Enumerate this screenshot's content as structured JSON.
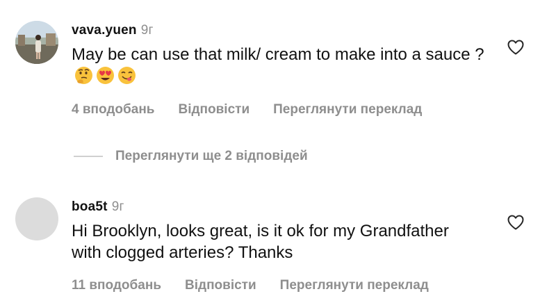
{
  "comments": [
    {
      "username": "vava.yuen",
      "time": "9г",
      "text": "May be can use that milk/ cream to make into a sauce ?",
      "emojis": [
        "thinking-face-emoji",
        "heart-eyes-emoji",
        "yum-face-emoji"
      ],
      "likes": "4 вподобань",
      "reply": "Відповісти",
      "translate": "Переглянути переклад"
    },
    {
      "username": "boa5t",
      "time": "9г",
      "text": "Hi Brooklyn, looks great, is it ok for my Grandfather with clogged arteries? Thanks",
      "likes": "11 вподобань",
      "reply": "Відповісти",
      "translate": "Переглянути переклад"
    }
  ],
  "view_replies": "Переглянути ще 2 відповідей",
  "colors": {
    "muted": "#8e8e8e",
    "text": "#111111",
    "avatar_placeholder": "#dcdcdc"
  }
}
